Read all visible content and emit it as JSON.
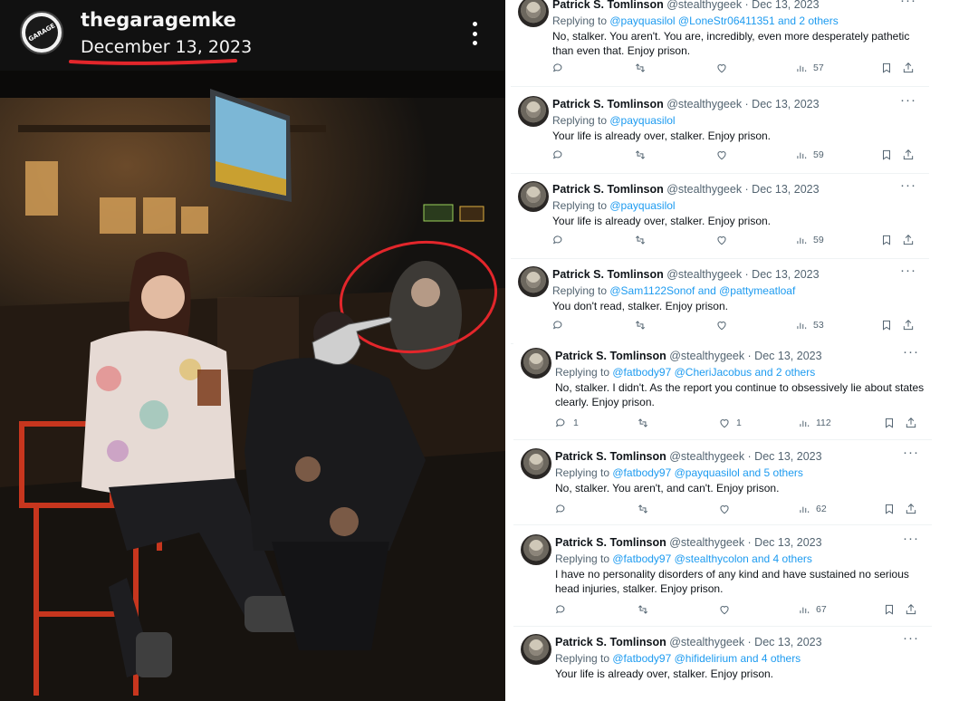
{
  "instagram": {
    "username": "thegaragemke",
    "date": "December 13, 2023",
    "avatar_text": "GARAGE"
  },
  "tweets": [
    {
      "name": "Patrick S. Tomlinson",
      "handle_date": "@stealthygeek · Dec 13, 2023",
      "replying_prefix": "Replying to ",
      "replying_to": "@payquasilol @LoneStr06411351 and 2 others",
      "text": "No, stalker. You aren't. You are, incredibly, even more desperately pathetic than even that. Enjoy prison.",
      "replies": "",
      "retweets": "",
      "likes": "",
      "views": "57"
    },
    {
      "name": "Patrick S. Tomlinson",
      "handle_date": "@stealthygeek · Dec 13, 2023",
      "replying_prefix": "Replying to ",
      "replying_to": "@payquasilol",
      "text": "Your life is already over, stalker. Enjoy prison.",
      "replies": "",
      "retweets": "",
      "likes": "",
      "views": "59"
    },
    {
      "name": "Patrick S. Tomlinson",
      "handle_date": "@stealthygeek · Dec 13, 2023",
      "replying_prefix": "Replying to ",
      "replying_to": "@payquasilol",
      "text": "Your life is already over, stalker. Enjoy prison.",
      "replies": "",
      "retweets": "",
      "likes": "",
      "views": "59"
    },
    {
      "name": "Patrick S. Tomlinson",
      "handle_date": "@stealthygeek · Dec 13, 2023",
      "replying_prefix": "Replying to ",
      "replying_to": "@Sam1122Sonof and @pattymeatloaf",
      "text": "You don't read, stalker. Enjoy prison.",
      "replies": "",
      "retweets": "",
      "likes": "",
      "views": "53"
    },
    {
      "name": "Patrick S. Tomlinson",
      "handle_date": "@stealthygeek · Dec 13, 2023",
      "replying_prefix": "Replying to ",
      "replying_to": "@fatbody97 @CheriJacobus and 2 others",
      "text": "No, stalker. I didn't. As the report you continue to obsessively lie about states clearly. Enjoy prison.",
      "replies": "1",
      "retweets": "",
      "likes": "1",
      "views": "112"
    },
    {
      "name": "Patrick S. Tomlinson",
      "handle_date": "@stealthygeek · Dec 13, 2023",
      "replying_prefix": "Replying to ",
      "replying_to": "@fatbody97 @payquasilol and 5 others",
      "text": "No, stalker. You aren't, and can't. Enjoy prison.",
      "replies": "",
      "retweets": "",
      "likes": "",
      "views": "62"
    },
    {
      "name": "Patrick S. Tomlinson",
      "handle_date": "@stealthygeek · Dec 13, 2023",
      "replying_prefix": "Replying to ",
      "replying_to": "@fatbody97 @stealthycolon and 4 others",
      "text": "I have no personality disorders of any kind and have sustained no serious head injuries, stalker. Enjoy prison.",
      "replies": "",
      "retweets": "",
      "likes": "",
      "views": "67"
    },
    {
      "name": "Patrick S. Tomlinson",
      "handle_date": "@stealthygeek · Dec 13, 2023",
      "replying_prefix": "Replying to ",
      "replying_to": "@fatbody97 @hifidelirium and 4 others",
      "text": "Your life is already over, stalker. Enjoy prison.",
      "replies": "",
      "retweets": "",
      "likes": "",
      "views": ""
    }
  ],
  "colors": {
    "accent": "#1d9bf0",
    "annotation_red": "#e3262b",
    "muted": "#536471"
  }
}
